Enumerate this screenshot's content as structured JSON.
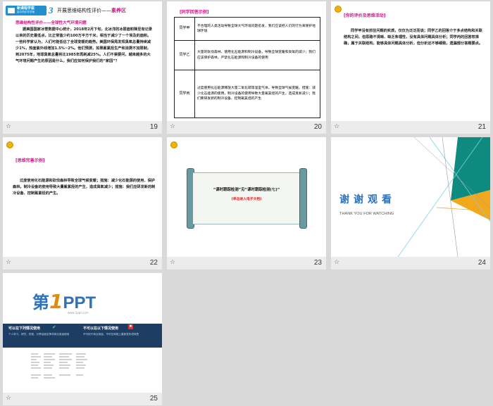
{
  "slides": [
    {
      "number": "19",
      "banner_logo": "新课程学案",
      "banner_sub": "高中同步导学案",
      "banner_num": "3",
      "banner_title": "开展思维结构性评价——",
      "banner_title_em": "素养区",
      "heading": "思维结构性评价——全球性大气环境问题",
      "body": "据美国国家冰雪数据中心统计，2018年2月下旬，北冰洋的冰层面积降至有记录以来的历史最低点，比正常值少约100万平方千米，相当于减少了一个埃及的面积。一些科学家认为，人们可能低估了全球变暖的趋势。美国环保局发现臭氧总量持续减少1%，热面紫外线增加1.5%~2%。他们预测，如果氟氯烃生产和消费不加限制，到2075年，地球臭氧总量将比1985年再耗减25%。人们不禁要问，越来越多的大气环境问题产生的原因是什么，我们应如何保护我们的“家园”？"
    },
    {
      "number": "20",
      "tag": "[同学回答示例]",
      "rows": [
        {
          "who": "同学甲",
          "text": "不合理的人类活动导致全球大气环境问题愈发，我们应该把人们的行为来保护地球环境"
        },
        {
          "who": "同学乙",
          "text": "大量的砍伐森林、使用化石能源和制冷设备，导致全球变暖和臭氧的减少；我们应该保护森林，严禁化石能源和制冷设备的使用"
        },
        {
          "who": "同学丙",
          "text": "过度使用化石能源释放大量二氧化碳等温室气体，导致全球气候变暖。措施：减少化石能源的使用，制冷设备的使用导致大量氟氯烃的产生，造成臭氧减少；我们要研发新的制冷设备、控制氟氯烃的产生"
        }
      ]
    },
    {
      "number": "21",
      "tag": "[你的评价及思维活动]",
      "body": "同学甲没有抓住问题的实质，仅仅为泛泛而谈；同学乙的回答介于多点结构和关联结构之间，但思路不清晰、缺乏条理性，没有具体问题具体分析；同学丙的回答较准确，属于关联结构，能够具体问题具体分析，但分析还不够细致，遗漏部分答题要点。"
    },
    {
      "number": "22",
      "tag": "[思维完善示例]",
      "body": "过度使用化石能源和砍伐森林导致全球气候变暖；措施：减少化石能源的使用、保护森林。制冷设备的使用导致大量氟氯烃的产生，造成臭氧减少；措施：我们应研发新的制冷设备、控制氟氯烃的产生。"
    },
    {
      "number": "23",
      "scroll_title": "“课时跟踪检测”见“课时跟踪检测(七)”",
      "scroll_sub": "(单击进入电子文档)"
    },
    {
      "number": "24",
      "thanks": "谢谢观看",
      "thanks_en": "THANK YOU FOR WATCHING"
    },
    {
      "number": "25",
      "logo_a": "第",
      "logo_b": "1",
      "logo_c": "PPT",
      "logo_url": "www.1ppt.com",
      "ok_title": "可以在下列情况使用",
      "no_title": "不可以在以下情况使用",
      "ok_text": "个人学习、研究、欣赏、分享给朋友等非商业用途使用",
      "no_text": "不可用于商业用途，不可在网络上重新发布或转售"
    }
  ],
  "footer_icon": "☆",
  "colors": {
    "magenta": "#d4128a",
    "scroll_red": "#e02020",
    "teal": "#0f8a7e",
    "orange": "#f2a81d",
    "navy": "#1d3d63",
    "logo_blue": "#2f72b6"
  }
}
